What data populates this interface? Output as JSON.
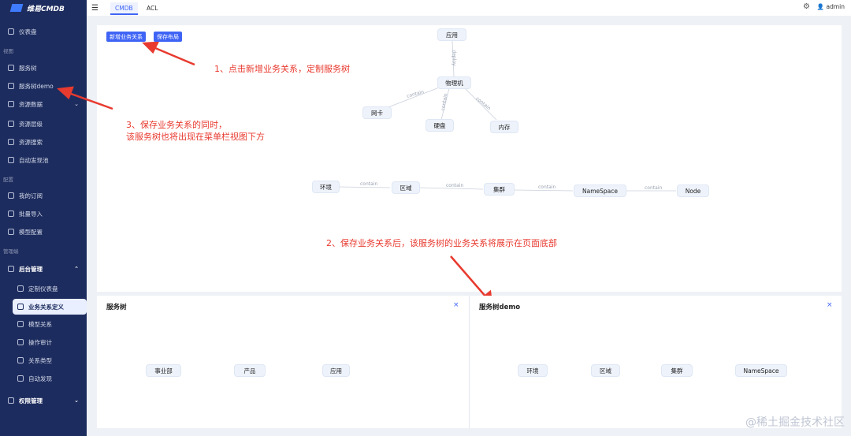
{
  "app": {
    "logo_text": "维易CMDB"
  },
  "sidebar": {
    "items": [
      {
        "label": "仪表盘"
      },
      {
        "group": "视图"
      },
      {
        "label": "服务树"
      },
      {
        "label": "服务树demo"
      },
      {
        "label": "资源数据"
      },
      {
        "label": "资源层级"
      },
      {
        "label": "资源搜索"
      },
      {
        "label": "自动发现池"
      },
      {
        "group": "配置"
      },
      {
        "label": "我的订阅"
      },
      {
        "label": "批量导入"
      },
      {
        "label": "模型配置"
      },
      {
        "group": "管理端"
      },
      {
        "label": "后台管理"
      },
      {
        "label": "定制仪表盘"
      },
      {
        "label": "业务关系定义"
      },
      {
        "label": "模型关系"
      },
      {
        "label": "操作审计"
      },
      {
        "label": "关系类型"
      },
      {
        "label": "自动发现"
      },
      {
        "label": "权限管理"
      }
    ]
  },
  "topbar": {
    "tabs": [
      "CMDB",
      "ACL"
    ],
    "user": "admin"
  },
  "toolbar": {
    "new_relation": "新增业务关系",
    "save_layout": "保存布局"
  },
  "graph_top": {
    "nodes": [
      "应用",
      "物理机",
      "网卡",
      "硬盘",
      "内存"
    ],
    "edges": [
      "deploy",
      "contain",
      "contain",
      "contain"
    ]
  },
  "graph_mid": {
    "nodes": [
      "环境",
      "区域",
      "集群",
      "NameSpace",
      "Node"
    ],
    "edges": [
      "contain",
      "contain",
      "contain",
      "contain"
    ]
  },
  "annotations": {
    "a1": "1、点击新增业务关系，定制服务树",
    "a2": "2、保存业务关系后，该服务树的业务关系将展示在页面底部",
    "a3_line1": "3、保存业务关系的同时，",
    "a3_line2": "该服务树也将出现在菜单栏视图下方"
  },
  "panels": [
    {
      "title": "服务树",
      "nodes": [
        "事业部",
        "产品",
        "应用"
      ]
    },
    {
      "title": "服务树demo",
      "nodes": [
        "环境",
        "区域",
        "集群",
        "NameSpace"
      ]
    }
  ],
  "close_glyph": "×",
  "watermark": "@稀土掘金技术社区",
  "colors": {
    "sidebar_bg": "#1d2c5e",
    "accent": "#3f64f5",
    "annotation": "#e83a2f"
  }
}
